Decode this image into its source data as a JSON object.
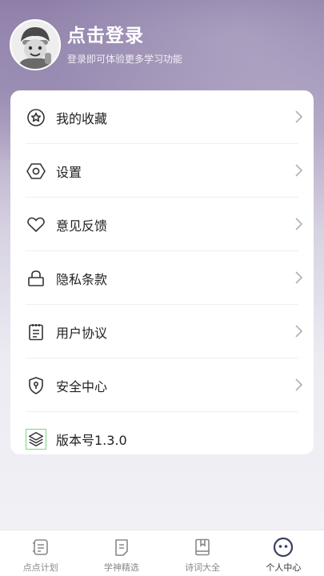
{
  "profile": {
    "title": "点击登录",
    "subtitle": "登录即可体验更多学习功能",
    "avatar_icon": "cartoon-boy-avatar"
  },
  "menu": {
    "items": [
      {
        "label": "我的收藏",
        "icon": "star-badge-icon",
        "has_arrow": true
      },
      {
        "label": "设置",
        "icon": "settings-hexagon-icon",
        "has_arrow": true
      },
      {
        "label": "意见反馈",
        "icon": "heart-icon",
        "has_arrow": true
      },
      {
        "label": "隐私条款",
        "icon": "lock-icon",
        "has_arrow": true
      },
      {
        "label": "用户协议",
        "icon": "clipboard-icon",
        "has_arrow": true
      },
      {
        "label": "安全中心",
        "icon": "shield-icon",
        "has_arrow": true
      },
      {
        "label": "版本号1.3.0",
        "icon": "layers-icon",
        "has_arrow": false
      }
    ]
  },
  "tabbar": {
    "tabs": [
      {
        "label": "点点计划",
        "icon": "plan-icon",
        "active": false
      },
      {
        "label": "学神精选",
        "icon": "document-icon",
        "active": false
      },
      {
        "label": "诗词大全",
        "icon": "book-icon",
        "active": false
      },
      {
        "label": "个人中心",
        "icon": "profile-face-icon",
        "active": true
      }
    ]
  },
  "colors": {
    "header": "#8e7fa9",
    "card": "#ffffff",
    "text": "#222222",
    "tab_inactive": "#888888",
    "tab_active": "#333333"
  }
}
